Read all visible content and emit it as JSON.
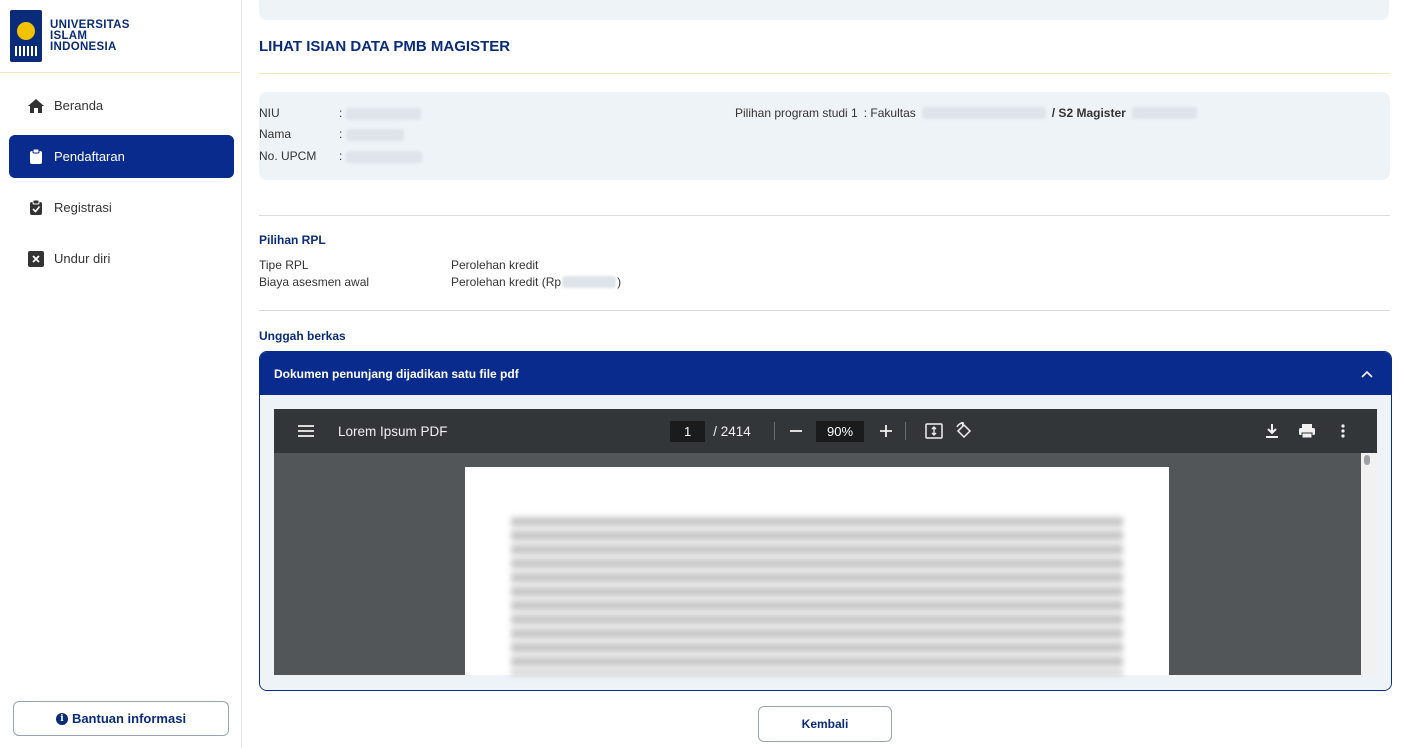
{
  "brand": {
    "line1": "UNIVERSITAS",
    "line2": "ISLAM",
    "line3": "INDONESIA"
  },
  "sidebar": {
    "items": [
      {
        "label": "Beranda",
        "icon": "home-icon",
        "active": false
      },
      {
        "label": "Pendaftaran",
        "icon": "clipboard-icon",
        "active": true
      },
      {
        "label": "Registrasi",
        "icon": "clipboard-check-icon",
        "active": false
      },
      {
        "label": "Undur diri",
        "icon": "close-square-icon",
        "active": false
      }
    ],
    "help_label": "Bantuan informasi"
  },
  "page": {
    "title": "LIHAT ISIAN DATA PMB MAGISTER"
  },
  "applicant": {
    "niu_label": "NIU",
    "name_label": "Nama",
    "upcm_label": "No. UPCM",
    "colon": ":",
    "program_label": "Pilihan program studi 1",
    "program_prefix": ": Fakultas",
    "program_suffix": "/ S2 Magister"
  },
  "rpl": {
    "title": "Pilihan RPL",
    "type_label": "Tipe RPL",
    "type_value": "Perolehan kredit",
    "fee_label": "Biaya asesmen awal",
    "fee_value_prefix": "Perolehan kredit (Rp",
    "fee_value_suffix": ")"
  },
  "upload": {
    "title": "Unggah berkas",
    "accordion_title": "Dokumen penunjang dijadikan satu file pdf"
  },
  "pdf_viewer": {
    "file_title": "Lorem Ipsum PDF",
    "current_page": "1",
    "total_pages": "/ 2414",
    "zoom": "90%"
  },
  "back_label": "Kembali",
  "colors": {
    "primary": "#0a2b8e",
    "panel": "#eef3f8",
    "accent_line": "#efe7bd"
  }
}
